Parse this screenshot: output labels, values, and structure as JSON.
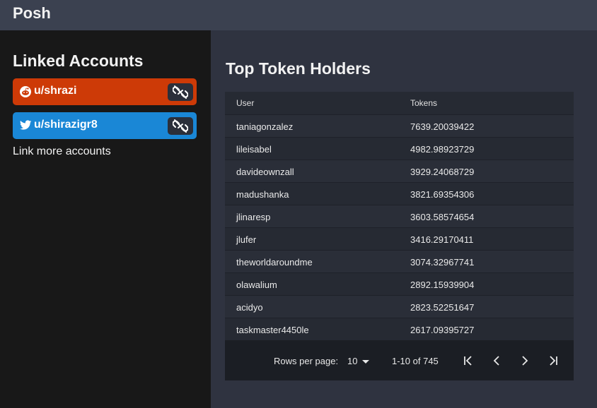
{
  "app": {
    "title": "Posh"
  },
  "sidebar": {
    "title": "Linked Accounts",
    "accounts": [
      {
        "service": "reddit",
        "icon": "reddit-icon",
        "label": "u/shrazi",
        "color": "#cd3a07"
      },
      {
        "service": "twitter",
        "icon": "twitter-icon",
        "label": "u/shirazigr8",
        "color": "#1a87d6"
      }
    ],
    "unlink_icon": "link-off-icon",
    "link_more": "Link more accounts"
  },
  "main": {
    "title": "Top Token Holders",
    "table": {
      "headers": {
        "user": "User",
        "tokens": "Tokens"
      },
      "rows": [
        {
          "user": "taniagonzalez",
          "tokens": "7639.20039422"
        },
        {
          "user": "lileisabel",
          "tokens": "4982.98923729"
        },
        {
          "user": "davideownzall",
          "tokens": "3929.24068729"
        },
        {
          "user": "madushanka",
          "tokens": "3821.69354306"
        },
        {
          "user": "jlinaresp",
          "tokens": "3603.58574654"
        },
        {
          "user": "jlufer",
          "tokens": "3416.29170411"
        },
        {
          "user": "theworldaroundme",
          "tokens": "3074.32967741"
        },
        {
          "user": "olawalium",
          "tokens": "2892.15939904"
        },
        {
          "user": "acidyo",
          "tokens": "2823.52251647"
        },
        {
          "user": "taskmaster4450le",
          "tokens": "2617.09395727"
        }
      ]
    },
    "pagination": {
      "rows_per_page_label": "Rows per page:",
      "rows_per_page": "10",
      "range": "1-10 of 745",
      "icons": [
        "first-page-icon",
        "previous-page-icon",
        "next-page-icon",
        "last-page-icon"
      ]
    }
  },
  "colors": {
    "background": "#2f3340",
    "topbar": "#3b4150",
    "sidebar": "#181818",
    "reddit": "#cd3a07",
    "twitter": "#1a87d6"
  }
}
